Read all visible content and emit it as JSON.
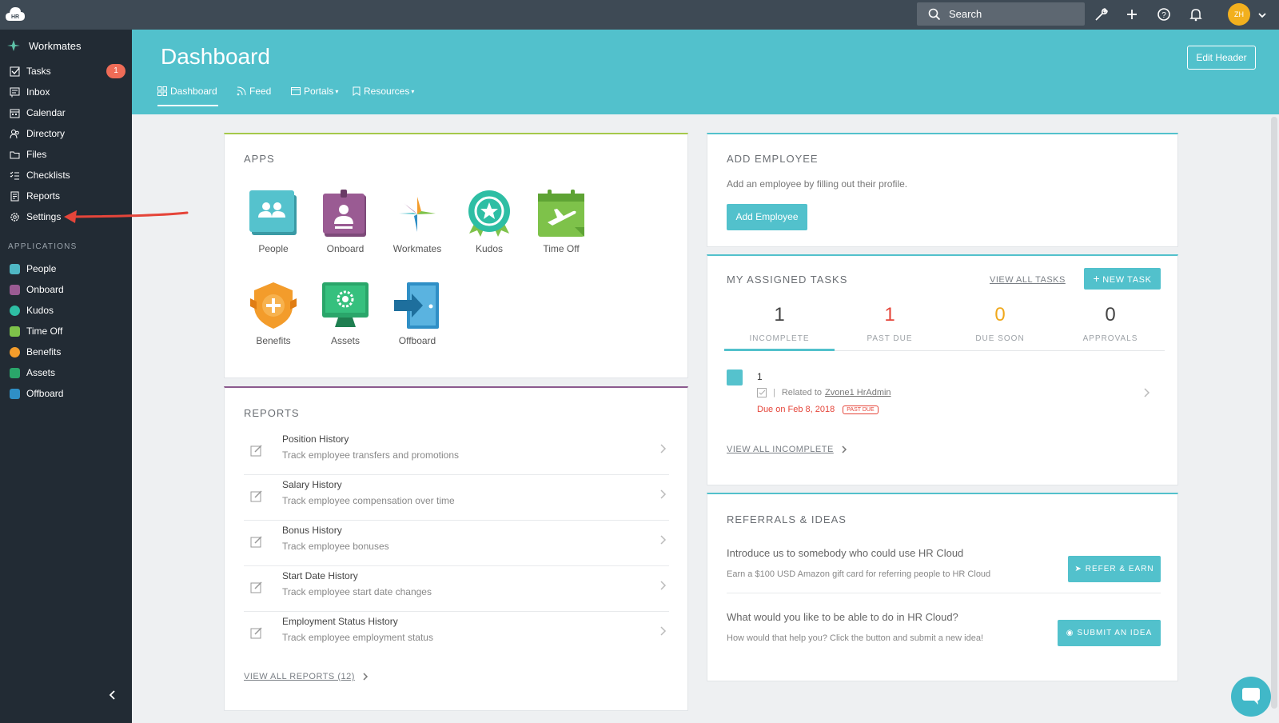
{
  "topbar": {
    "logo_text": "HR",
    "search_label": "Search",
    "avatar_initials": "ZH"
  },
  "sidebar": {
    "brand": "Workmates",
    "items": [
      {
        "label": "Tasks",
        "badge": "1"
      },
      {
        "label": "Inbox"
      },
      {
        "label": "Calendar"
      },
      {
        "label": "Directory"
      },
      {
        "label": "Files"
      },
      {
        "label": "Checklists"
      },
      {
        "label": "Reports"
      },
      {
        "label": "Settings"
      }
    ],
    "applications_label": "APPLICATIONS",
    "apps": [
      {
        "label": "People",
        "color": "#4fb7c4"
      },
      {
        "label": "Onboard",
        "color": "#9a5b93"
      },
      {
        "label": "Kudos",
        "color": "#2ebea4"
      },
      {
        "label": "Time Off",
        "color": "#7ec24a"
      },
      {
        "label": "Benefits",
        "color": "#f39c2b"
      },
      {
        "label": "Assets",
        "color": "#2aa66a"
      },
      {
        "label": "Offboard",
        "color": "#2f8fc6"
      }
    ]
  },
  "header": {
    "title": "Dashboard",
    "edit_button": "Edit Header",
    "tabs": [
      {
        "label": "Dashboard"
      },
      {
        "label": "Feed"
      },
      {
        "label": "Portals"
      },
      {
        "label": "Resources"
      }
    ]
  },
  "apps": {
    "title": "APPS",
    "tiles": [
      "People",
      "Onboard",
      "Workmates",
      "Kudos",
      "Time Off",
      "Benefits",
      "Assets",
      "Offboard"
    ]
  },
  "reports": {
    "title": "REPORTS",
    "rows": [
      {
        "title": "Position History",
        "desc": "Track employee transfers and promotions"
      },
      {
        "title": "Salary History",
        "desc": "Track employee compensation over time"
      },
      {
        "title": "Bonus History",
        "desc": "Track employee bonuses"
      },
      {
        "title": "Start Date History",
        "desc": "Track employee start date changes"
      },
      {
        "title": "Employment Status History",
        "desc": "Track employee employment status"
      }
    ],
    "view_all": "VIEW ALL REPORTS (12)"
  },
  "add_employee": {
    "title": "ADD EMPLOYEE",
    "desc": "Add an employee by filling out their profile.",
    "button": "Add Employee"
  },
  "tasks": {
    "title": "MY ASSIGNED TASKS",
    "view_all": "VIEW ALL TASKS",
    "new_task": "NEW TASK",
    "stats": [
      {
        "num": "1",
        "label": "INCOMPLETE",
        "color": "#444444"
      },
      {
        "num": "1",
        "label": "PAST DUE",
        "color": "#e5453a"
      },
      {
        "num": "0",
        "label": "DUE SOON",
        "color": "#f0a81c"
      },
      {
        "num": "0",
        "label": "APPROVALS",
        "color": "#444444"
      }
    ],
    "item": {
      "count": "1",
      "related_prefix": "Related to",
      "related_name": "Zvone1 HrAdmin",
      "due": "Due on Feb 8, 2018",
      "flag": "PAST DUE"
    },
    "view_incomplete": "VIEW ALL INCOMPLETE"
  },
  "referrals": {
    "title": "REFERRALS & IDEAS",
    "q1": "Introduce us to somebody who could use HR Cloud",
    "d1": "Earn a $100 USD Amazon gift card for referring people to HR Cloud",
    "b1": "REFER & EARN",
    "q2": "What would you like to be able to do in HR Cloud?",
    "d2": "How would that help you? Click the button and submit a new idea!",
    "b2": "SUBMIT AN IDEA"
  }
}
